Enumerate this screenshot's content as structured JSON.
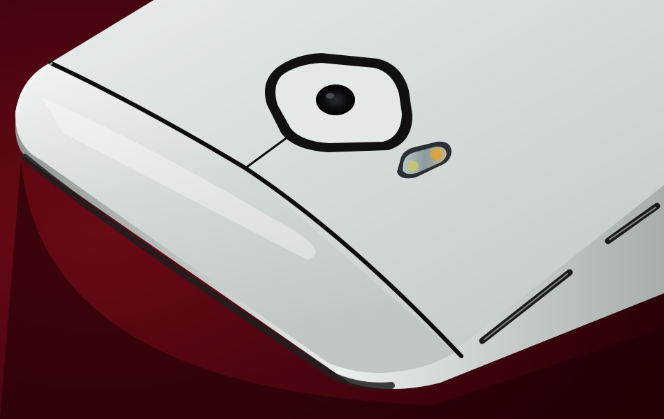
{
  "scene": {
    "subject": "phone-back-closeup",
    "colors": {
      "backdrop": "#5a0610",
      "backdrop_dark": "#2a0004",
      "body_light": "#dfe5e3",
      "body_mid": "#c9cfcd",
      "body_dark": "#9aa19f",
      "antenna_band": "#0c0c0c",
      "camera_ring": "#101010",
      "lens": "#0a0a0c",
      "flash_warm": "#e0a23a",
      "flash_cool": "#c9c46a",
      "button_edge": "#1a1a1a"
    },
    "parts": [
      "velvet-backdrop",
      "phone-body",
      "antenna-band",
      "camera-module",
      "camera-lens",
      "dual-tone-flash",
      "volume-button",
      "power-button"
    ]
  }
}
